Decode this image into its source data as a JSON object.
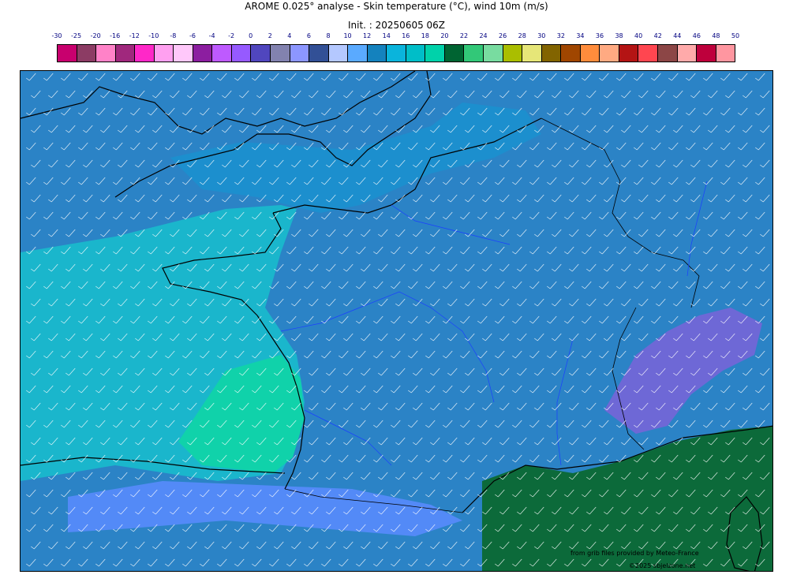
{
  "header": {
    "title": "AROME 0.025° analyse - Skin temperature (°C), wind 10m (m/s)",
    "init": "Init. : 20250605 06Z"
  },
  "legend": {
    "labels": [
      "-30",
      "-25",
      "-20",
      "-16",
      "-12",
      "-10",
      "-8",
      "-6",
      "-4",
      "-2",
      "0",
      "2",
      "4",
      "6",
      "8",
      "10",
      "12",
      "14",
      "16",
      "18",
      "20",
      "22",
      "24",
      "26",
      "28",
      "30",
      "32",
      "34",
      "36",
      "38",
      "40",
      "42",
      "44",
      "46",
      "48",
      "50"
    ],
    "colors": [
      "#c8006e",
      "#8c3c64",
      "#ff82c8",
      "#a0287d",
      "#ff28c8",
      "#ffa0f0",
      "#ffc8fa",
      "#8c1ea0",
      "#be5aff",
      "#965aff",
      "#5046be",
      "#8282af",
      "#8c96ff",
      "#325096",
      "#b4c8ff",
      "#5aaaff",
      "#1482be",
      "#0ab4dc",
      "#00bec8",
      "#00d2aa",
      "#006432",
      "#32c878",
      "#78dca0",
      "#aabe00",
      "#e6e678",
      "#826400",
      "#a04600",
      "#ff8c3c",
      "#ffaa82",
      "#b41414",
      "#ff4650",
      "#8c4646",
      "#ffaaaa",
      "#be003c",
      "#ff96a0"
    ]
  },
  "map": {
    "base_color": "#2b83c6",
    "sea_color": "#1ab6cc",
    "warm_sea_color": "#10d2aa",
    "med_color": "#0c6a3a",
    "coast_color": "#000000",
    "river_color": "#1b3fff",
    "barb_color": "#ffffff"
  },
  "credits": {
    "source": "from grib files provided by Meteo-France",
    "copyright": "©2025 sbjelzone.net"
  }
}
